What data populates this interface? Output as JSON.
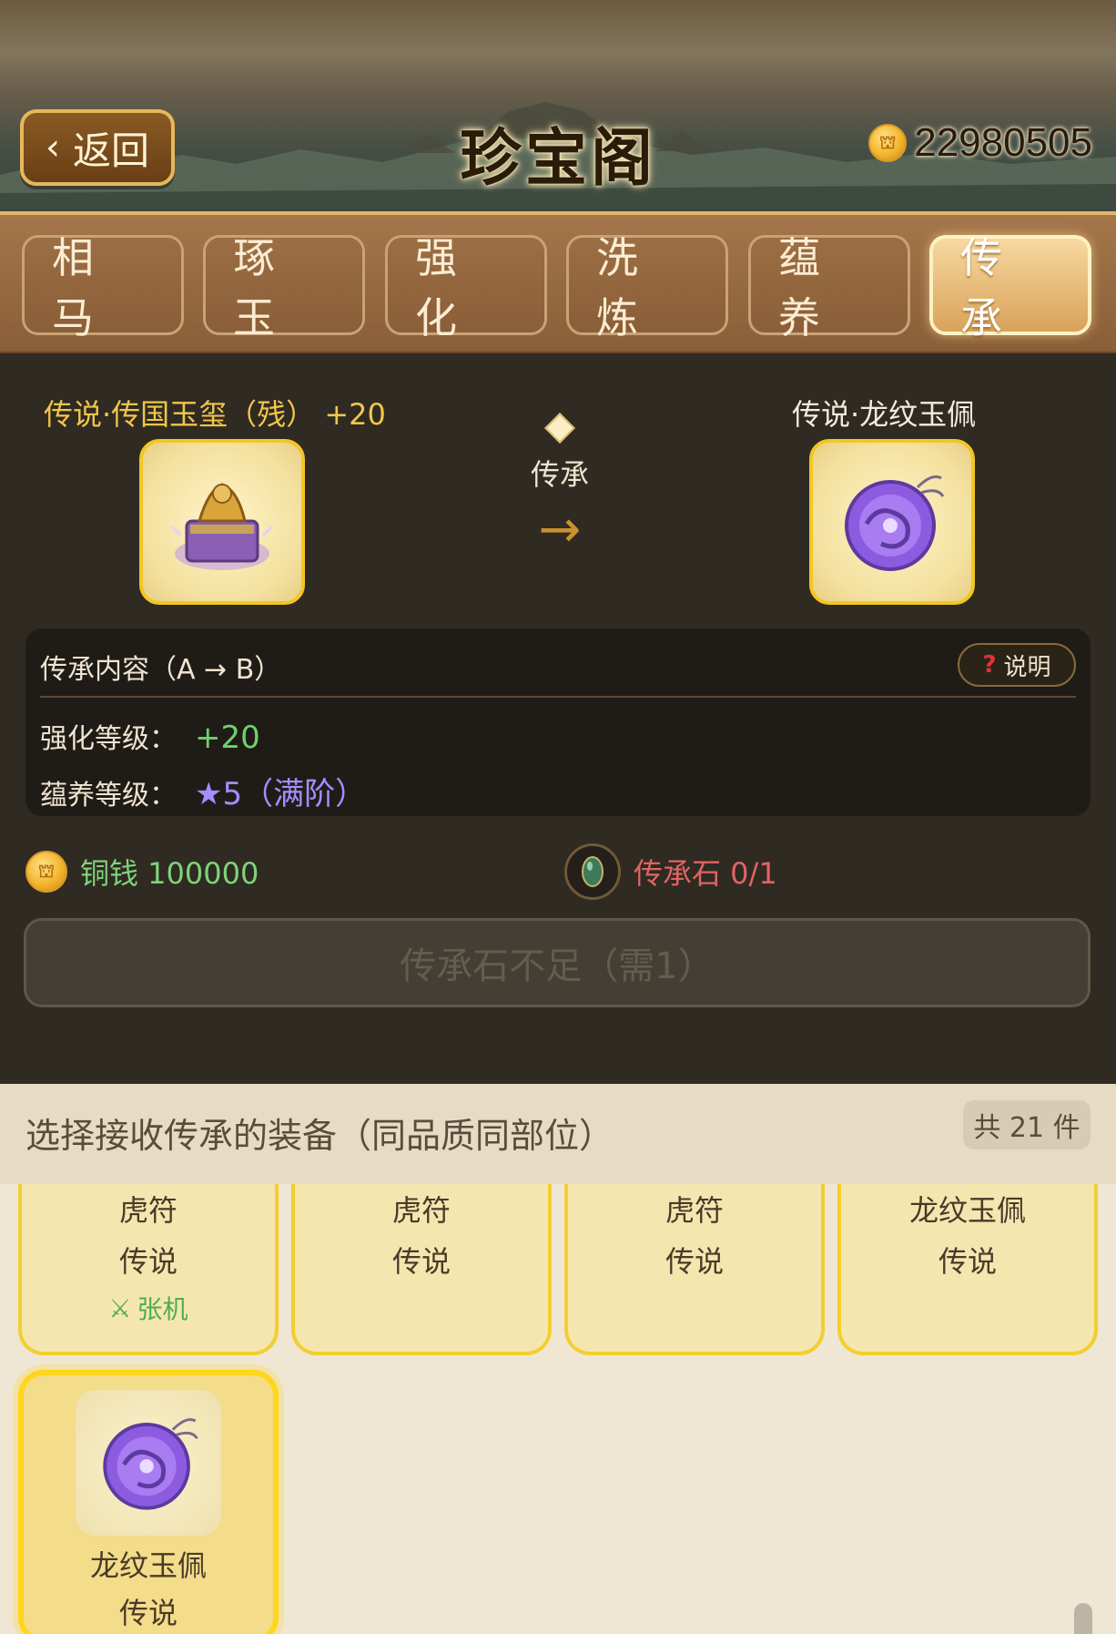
{
  "header": {
    "back_label": "返回",
    "title": "珍宝阁",
    "coins": "22980505"
  },
  "tabs": [
    {
      "label": "相马",
      "active": false
    },
    {
      "label": "琢玉",
      "active": false
    },
    {
      "label": "强化",
      "active": false
    },
    {
      "label": "洗炼",
      "active": false
    },
    {
      "label": "蕴养",
      "active": false
    },
    {
      "label": "传承",
      "active": true
    }
  ],
  "transfer": {
    "source_name": "传说·传国玉玺（残） +20",
    "source_icon": "jade-seal-icon",
    "target_name": "传说·龙纹玉佩",
    "target_icon": "dragon-jade-pendant-icon",
    "mid_label": "传承"
  },
  "panel": {
    "title": "传承内容（A → B）",
    "help_label": "说明",
    "enhance_label": "强化等级：",
    "enhance_value": "+20",
    "nourish_label": "蕴养等级：",
    "nourish_value": "★5（满阶）"
  },
  "cost": {
    "copper": "铜钱 100000",
    "stone": "传承石 0/1"
  },
  "action_button": "传承石不足（需1）",
  "select": {
    "title": "选择接收传承的装备（同品质同部位）",
    "count": "共 21 件",
    "items": [
      {
        "name": "虎符",
        "rarity": "传说",
        "owner": "张机"
      },
      {
        "name": "虎符",
        "rarity": "传说",
        "owner": ""
      },
      {
        "name": "虎符",
        "rarity": "传说",
        "owner": ""
      },
      {
        "name": "龙纹玉佩",
        "rarity": "传说",
        "owner": ""
      },
      {
        "name": "龙纹玉佩",
        "rarity": "传说",
        "owner": "",
        "selected": true
      }
    ]
  },
  "colors": {
    "gold_accent": "#f2c624",
    "legend_text": "#f1c64a",
    "green_value": "#6fd36a",
    "purple_value": "#a58cff",
    "red_value": "#e06464"
  }
}
